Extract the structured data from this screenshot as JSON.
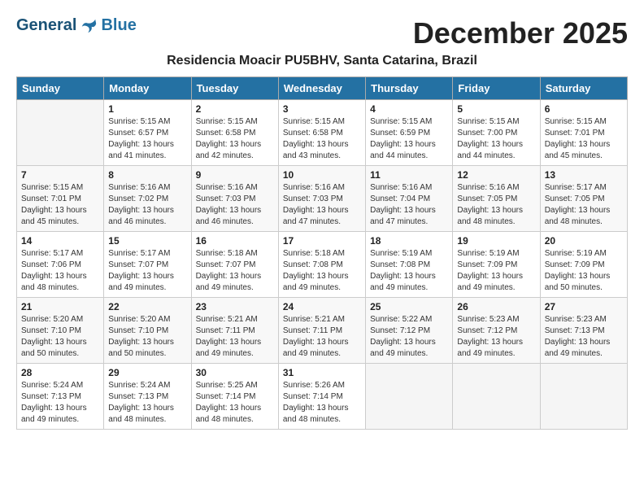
{
  "header": {
    "logo_general": "General",
    "logo_blue": "Blue",
    "month_title": "December 2025",
    "subtitle": "Residencia Moacir PU5BHV, Santa Catarina, Brazil"
  },
  "days_of_week": [
    "Sunday",
    "Monday",
    "Tuesday",
    "Wednesday",
    "Thursday",
    "Friday",
    "Saturday"
  ],
  "weeks": [
    [
      {
        "day": "",
        "sunrise": "",
        "sunset": "",
        "daylight": ""
      },
      {
        "day": "1",
        "sunrise": "Sunrise: 5:15 AM",
        "sunset": "Sunset: 6:57 PM",
        "daylight": "Daylight: 13 hours and 41 minutes."
      },
      {
        "day": "2",
        "sunrise": "Sunrise: 5:15 AM",
        "sunset": "Sunset: 6:58 PM",
        "daylight": "Daylight: 13 hours and 42 minutes."
      },
      {
        "day": "3",
        "sunrise": "Sunrise: 5:15 AM",
        "sunset": "Sunset: 6:58 PM",
        "daylight": "Daylight: 13 hours and 43 minutes."
      },
      {
        "day": "4",
        "sunrise": "Sunrise: 5:15 AM",
        "sunset": "Sunset: 6:59 PM",
        "daylight": "Daylight: 13 hours and 44 minutes."
      },
      {
        "day": "5",
        "sunrise": "Sunrise: 5:15 AM",
        "sunset": "Sunset: 7:00 PM",
        "daylight": "Daylight: 13 hours and 44 minutes."
      },
      {
        "day": "6",
        "sunrise": "Sunrise: 5:15 AM",
        "sunset": "Sunset: 7:01 PM",
        "daylight": "Daylight: 13 hours and 45 minutes."
      }
    ],
    [
      {
        "day": "7",
        "sunrise": "Sunrise: 5:15 AM",
        "sunset": "Sunset: 7:01 PM",
        "daylight": "Daylight: 13 hours and 45 minutes."
      },
      {
        "day": "8",
        "sunrise": "Sunrise: 5:16 AM",
        "sunset": "Sunset: 7:02 PM",
        "daylight": "Daylight: 13 hours and 46 minutes."
      },
      {
        "day": "9",
        "sunrise": "Sunrise: 5:16 AM",
        "sunset": "Sunset: 7:03 PM",
        "daylight": "Daylight: 13 hours and 46 minutes."
      },
      {
        "day": "10",
        "sunrise": "Sunrise: 5:16 AM",
        "sunset": "Sunset: 7:03 PM",
        "daylight": "Daylight: 13 hours and 47 minutes."
      },
      {
        "day": "11",
        "sunrise": "Sunrise: 5:16 AM",
        "sunset": "Sunset: 7:04 PM",
        "daylight": "Daylight: 13 hours and 47 minutes."
      },
      {
        "day": "12",
        "sunrise": "Sunrise: 5:16 AM",
        "sunset": "Sunset: 7:05 PM",
        "daylight": "Daylight: 13 hours and 48 minutes."
      },
      {
        "day": "13",
        "sunrise": "Sunrise: 5:17 AM",
        "sunset": "Sunset: 7:05 PM",
        "daylight": "Daylight: 13 hours and 48 minutes."
      }
    ],
    [
      {
        "day": "14",
        "sunrise": "Sunrise: 5:17 AM",
        "sunset": "Sunset: 7:06 PM",
        "daylight": "Daylight: 13 hours and 48 minutes."
      },
      {
        "day": "15",
        "sunrise": "Sunrise: 5:17 AM",
        "sunset": "Sunset: 7:07 PM",
        "daylight": "Daylight: 13 hours and 49 minutes."
      },
      {
        "day": "16",
        "sunrise": "Sunrise: 5:18 AM",
        "sunset": "Sunset: 7:07 PM",
        "daylight": "Daylight: 13 hours and 49 minutes."
      },
      {
        "day": "17",
        "sunrise": "Sunrise: 5:18 AM",
        "sunset": "Sunset: 7:08 PM",
        "daylight": "Daylight: 13 hours and 49 minutes."
      },
      {
        "day": "18",
        "sunrise": "Sunrise: 5:19 AM",
        "sunset": "Sunset: 7:08 PM",
        "daylight": "Daylight: 13 hours and 49 minutes."
      },
      {
        "day": "19",
        "sunrise": "Sunrise: 5:19 AM",
        "sunset": "Sunset: 7:09 PM",
        "daylight": "Daylight: 13 hours and 49 minutes."
      },
      {
        "day": "20",
        "sunrise": "Sunrise: 5:19 AM",
        "sunset": "Sunset: 7:09 PM",
        "daylight": "Daylight: 13 hours and 50 minutes."
      }
    ],
    [
      {
        "day": "21",
        "sunrise": "Sunrise: 5:20 AM",
        "sunset": "Sunset: 7:10 PM",
        "daylight": "Daylight: 13 hours and 50 minutes."
      },
      {
        "day": "22",
        "sunrise": "Sunrise: 5:20 AM",
        "sunset": "Sunset: 7:10 PM",
        "daylight": "Daylight: 13 hours and 50 minutes."
      },
      {
        "day": "23",
        "sunrise": "Sunrise: 5:21 AM",
        "sunset": "Sunset: 7:11 PM",
        "daylight": "Daylight: 13 hours and 49 minutes."
      },
      {
        "day": "24",
        "sunrise": "Sunrise: 5:21 AM",
        "sunset": "Sunset: 7:11 PM",
        "daylight": "Daylight: 13 hours and 49 minutes."
      },
      {
        "day": "25",
        "sunrise": "Sunrise: 5:22 AM",
        "sunset": "Sunset: 7:12 PM",
        "daylight": "Daylight: 13 hours and 49 minutes."
      },
      {
        "day": "26",
        "sunrise": "Sunrise: 5:23 AM",
        "sunset": "Sunset: 7:12 PM",
        "daylight": "Daylight: 13 hours and 49 minutes."
      },
      {
        "day": "27",
        "sunrise": "Sunrise: 5:23 AM",
        "sunset": "Sunset: 7:13 PM",
        "daylight": "Daylight: 13 hours and 49 minutes."
      }
    ],
    [
      {
        "day": "28",
        "sunrise": "Sunrise: 5:24 AM",
        "sunset": "Sunset: 7:13 PM",
        "daylight": "Daylight: 13 hours and 49 minutes."
      },
      {
        "day": "29",
        "sunrise": "Sunrise: 5:24 AM",
        "sunset": "Sunset: 7:13 PM",
        "daylight": "Daylight: 13 hours and 48 minutes."
      },
      {
        "day": "30",
        "sunrise": "Sunrise: 5:25 AM",
        "sunset": "Sunset: 7:14 PM",
        "daylight": "Daylight: 13 hours and 48 minutes."
      },
      {
        "day": "31",
        "sunrise": "Sunrise: 5:26 AM",
        "sunset": "Sunset: 7:14 PM",
        "daylight": "Daylight: 13 hours and 48 minutes."
      },
      {
        "day": "",
        "sunrise": "",
        "sunset": "",
        "daylight": ""
      },
      {
        "day": "",
        "sunrise": "",
        "sunset": "",
        "daylight": ""
      },
      {
        "day": "",
        "sunrise": "",
        "sunset": "",
        "daylight": ""
      }
    ]
  ]
}
